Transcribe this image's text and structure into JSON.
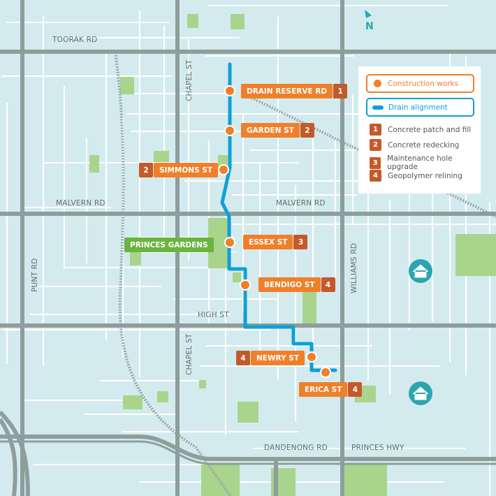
{
  "colors": {
    "water_bg": "#d3ebee",
    "main_road": "#8d9e9b",
    "park": "#a9d48c",
    "drain": "#0ea0d8",
    "construction": "#f07f2a",
    "number_badge": "#c45a2a",
    "landmark": "#6ab440",
    "home": "#2aa6b0"
  },
  "north_label": "N",
  "roads": {
    "toorak": "TOORAK RD",
    "malvern_w": "MALVERN RD",
    "malvern_e": "MALVERN RD",
    "high": "HIGH ST",
    "dandenong": "DANDENONG RD",
    "princes_hwy": "PRINCES HWY",
    "punt": "PUNT RD",
    "chapel_n": "CHAPEL ST",
    "chapel_s": "CHAPEL ST",
    "williams": "WILLIAMS RD"
  },
  "landmark": {
    "label": "PRINCES GARDENS"
  },
  "sites": [
    {
      "label": "DRAIN RESERVE RD",
      "num": "1"
    },
    {
      "label": "GARDEN ST",
      "num": "2"
    },
    {
      "label": "SIMMONS ST",
      "num": "2"
    },
    {
      "label": "ESSEX ST",
      "num": "3"
    },
    {
      "label": "BENDIGO ST",
      "num": "4"
    },
    {
      "label": "NEWRY ST",
      "num": "4"
    },
    {
      "label": "ERICA ST",
      "num": "4"
    }
  ],
  "legend": {
    "construction": "Construction works",
    "drain": "Drain alignment",
    "items": [
      {
        "num": "1",
        "label": "Concrete patch and fill"
      },
      {
        "num": "2",
        "label": "Concrete redecking"
      },
      {
        "num": "3",
        "label": "Maintenance hole upgrade"
      },
      {
        "num": "4",
        "label": "Geopolymer relining"
      }
    ]
  },
  "icons": [
    "home-icon",
    "home-icon",
    "north-arrow-icon"
  ]
}
